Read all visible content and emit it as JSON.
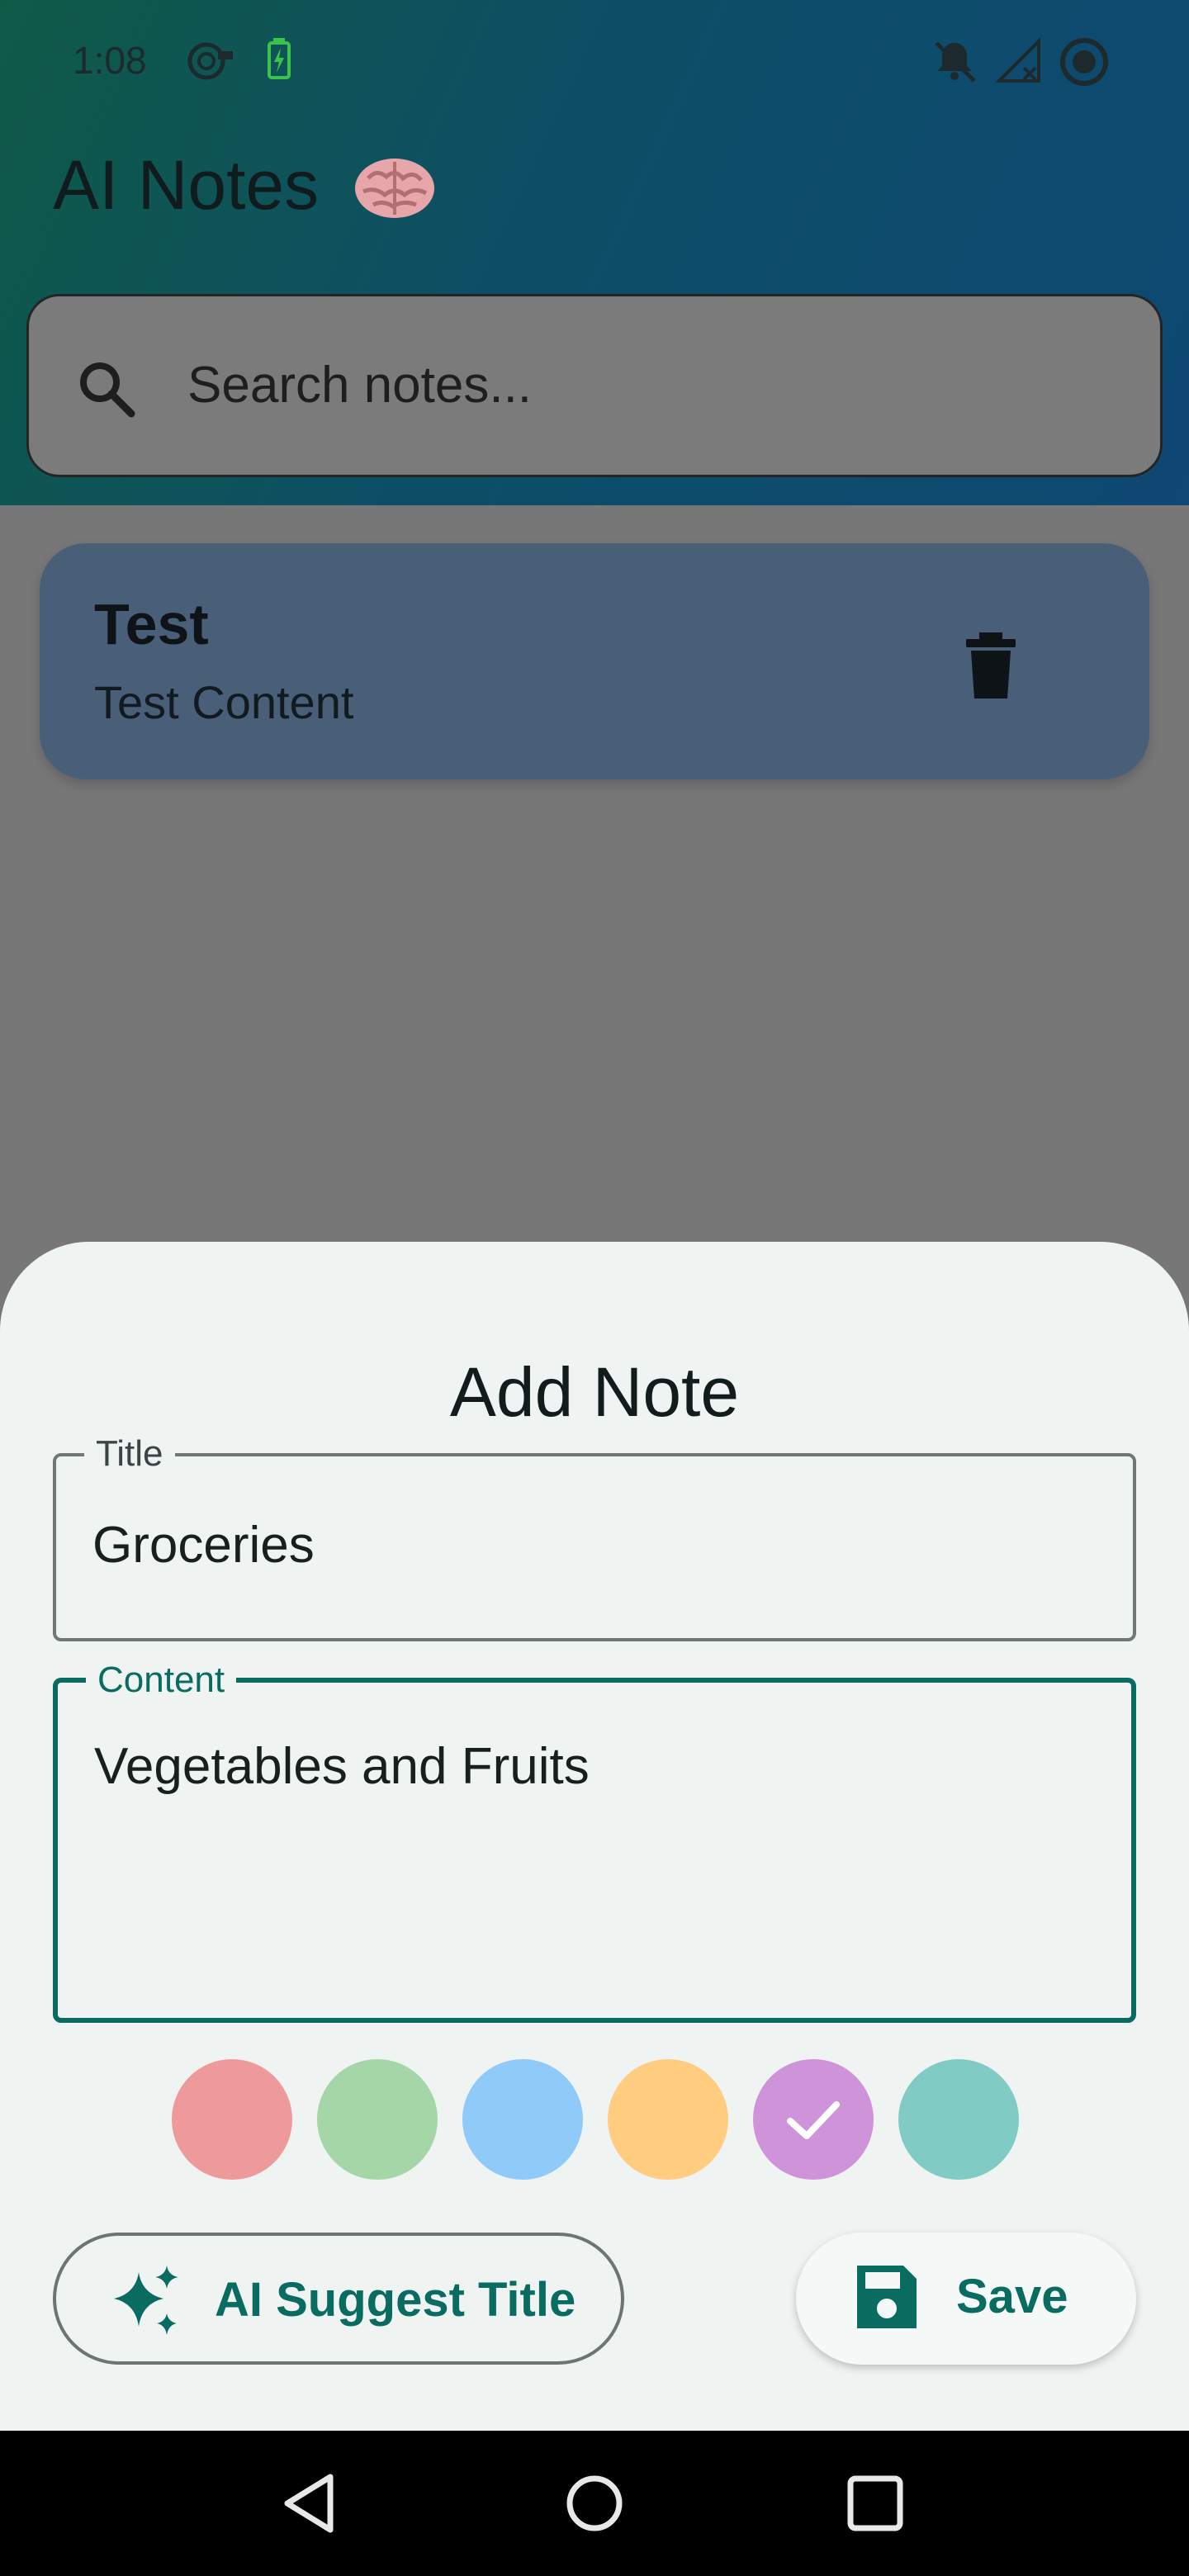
{
  "status_bar": {
    "time": "1:08",
    "icons": [
      "podcast-icon",
      "battery-charging-icon",
      "notifications-off-icon",
      "no-signal-icon",
      "record-icon"
    ]
  },
  "app": {
    "title": "AI Notes",
    "title_emoji_icon": "brain-icon",
    "search": {
      "placeholder": "Search notes...",
      "icon": "search-icon"
    },
    "notes": [
      {
        "title": "Test",
        "content": "Test Content",
        "action_icon": "trash-icon",
        "color": "#495f78"
      }
    ]
  },
  "sheet": {
    "title": "Add Note",
    "title_field": {
      "label": "Title",
      "value": "Groceries"
    },
    "content_field": {
      "label": "Content",
      "value": "Vegetables and Fruits"
    },
    "colors": [
      {
        "name": "red",
        "hex": "#ef9a9a",
        "selected": false
      },
      {
        "name": "green",
        "hex": "#a5d6a7",
        "selected": false
      },
      {
        "name": "blue",
        "hex": "#90caf9",
        "selected": false
      },
      {
        "name": "orange",
        "hex": "#ffcc80",
        "selected": false
      },
      {
        "name": "purple",
        "hex": "#ce93d8",
        "selected": true
      },
      {
        "name": "teal",
        "hex": "#80cbc4",
        "selected": false
      }
    ],
    "ai_button_label": "AI Suggest Title",
    "save_button_label": "Save"
  },
  "nav_bar": {
    "icons": [
      "back-icon",
      "home-icon",
      "recents-icon"
    ]
  },
  "theme": {
    "accent": "#0a6b61",
    "sheet_bg": "#eff4f3",
    "scrim": "#777777"
  }
}
